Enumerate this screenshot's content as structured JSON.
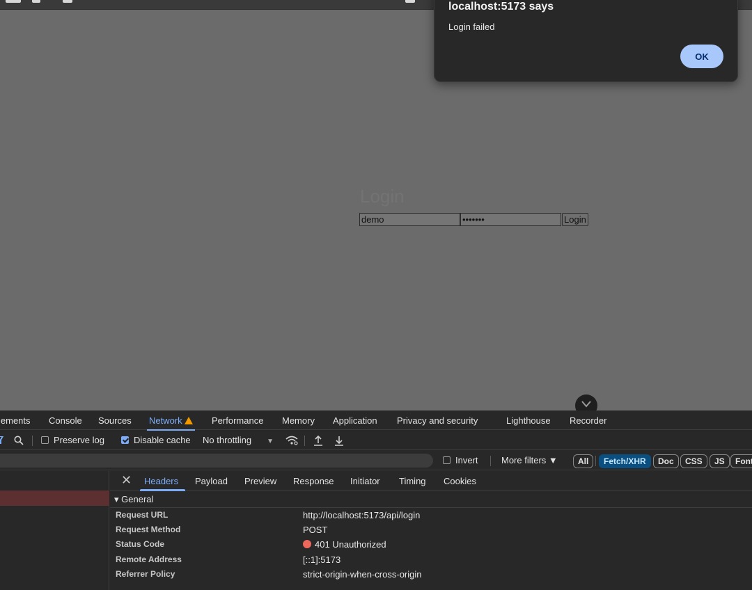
{
  "dialog": {
    "title": "localhost:5173 says",
    "message": "Login failed",
    "ok_label": "OK"
  },
  "page": {
    "title": "Login",
    "username_value": "demo",
    "password_value": "•••••••",
    "submit_label": "Login"
  },
  "devtools": {
    "tabs": [
      "lements",
      "Console",
      "Sources",
      "Network",
      "Performance",
      "Memory",
      "Application",
      "Privacy and security",
      "Lighthouse",
      "Recorder"
    ],
    "active_tab": "Network",
    "toolbar": {
      "preserve_log": "Preserve log",
      "disable_cache": "Disable cache",
      "throttling": "No throttling"
    },
    "filters": {
      "invert": "Invert",
      "more_filters": "More filters ▼",
      "chips": [
        "All",
        "Fetch/XHR",
        "Doc",
        "CSS",
        "JS",
        "Font"
      ],
      "active_chip": "Fetch/XHR"
    },
    "detail_tabs": [
      "Headers",
      "Payload",
      "Preview",
      "Response",
      "Initiator",
      "Timing",
      "Cookies"
    ],
    "active_detail_tab": "Headers",
    "general_label": "▾ General",
    "general": [
      {
        "key": "Request URL",
        "value": "http://localhost:5173/api/login"
      },
      {
        "key": "Request Method",
        "value": "POST"
      },
      {
        "key": "Status Code",
        "value": "401 Unauthorized"
      },
      {
        "key": "Remote Address",
        "value": "[::1]:5173"
      },
      {
        "key": "Referrer Policy",
        "value": "strict-origin-when-cross-origin"
      }
    ]
  },
  "colors": {
    "accent": "#7cacf8",
    "error_dot": "#ee675c",
    "warning": "#f29900",
    "dialog_button": "#a8c7fa"
  }
}
